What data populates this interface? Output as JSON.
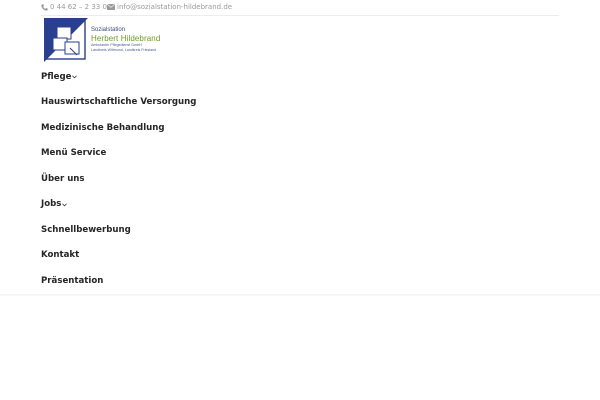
{
  "topbar": {
    "phone_icon": "phone-icon",
    "phone": "0 44 62 – 2 33 04",
    "mail_icon": "envelope-icon",
    "email": "info@sozialstation-hildebrand.de"
  },
  "logo": {
    "line1": "Sozialstation",
    "line2": "Herbert Hildebrand",
    "line3": "Ambulanter Pflegedienst GmbH",
    "line4": "Landkreis Wittmund, Landkreis Friesland",
    "colors": {
      "blue": "#2a3f8f",
      "green": "#6a9a2a"
    }
  },
  "menu": {
    "items": [
      {
        "label": "Pflege",
        "has_submenu": true
      },
      {
        "label": "Hauswirtschaftliche Versorgung",
        "has_submenu": false
      },
      {
        "label": "Medizinische Behandlung",
        "has_submenu": false
      },
      {
        "label": "Menü Service",
        "has_submenu": false
      },
      {
        "label": "Über uns",
        "has_submenu": false
      },
      {
        "label": "Jobs",
        "has_submenu": true
      },
      {
        "label": "Schnellbewerbung",
        "has_submenu": false
      },
      {
        "label": "Kontakt",
        "has_submenu": false
      },
      {
        "label": "Präsentation",
        "has_submenu": false
      }
    ],
    "caret_icon": "chevron-down-icon"
  }
}
